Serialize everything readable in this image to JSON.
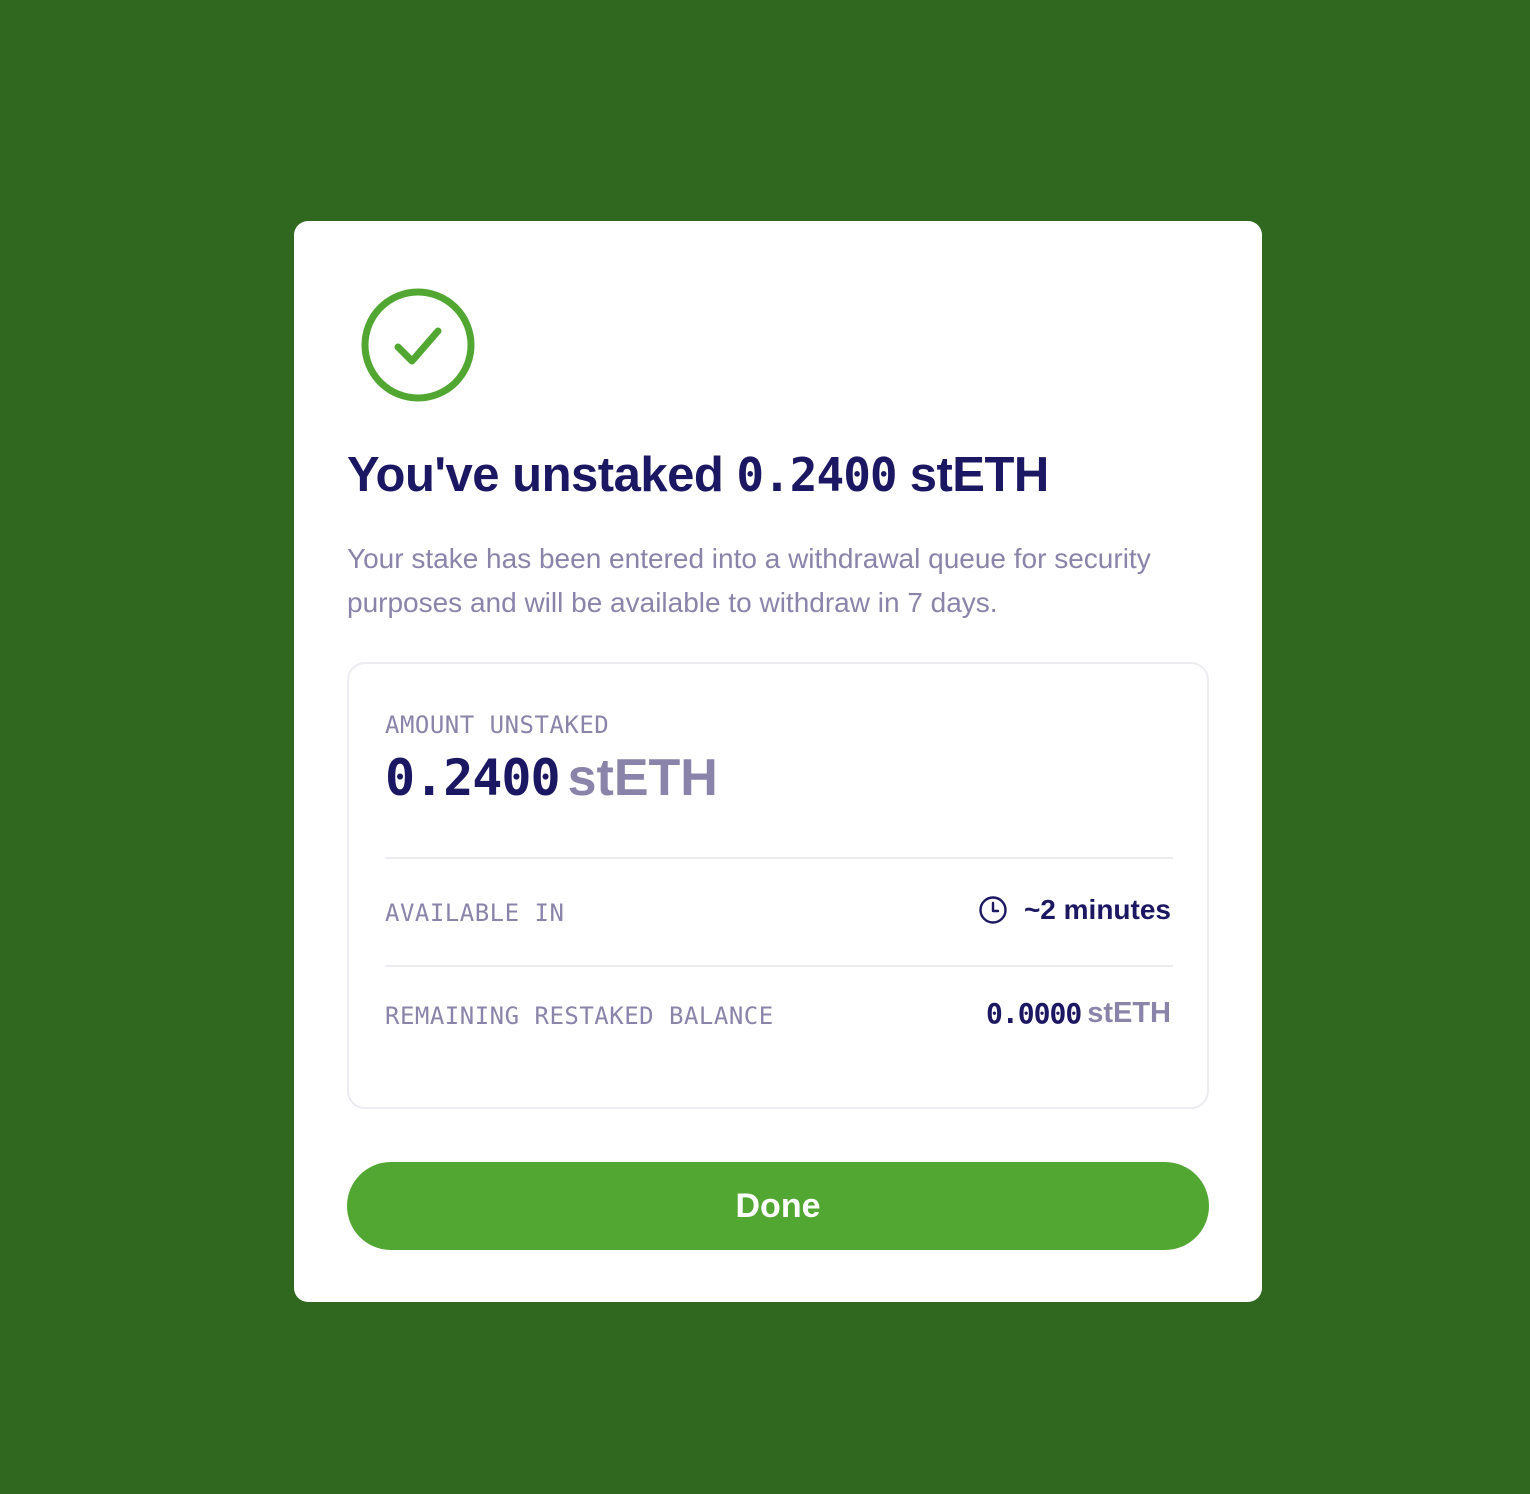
{
  "modal": {
    "icon": "check-circle-icon",
    "title_prefix": "You've unstaked",
    "title_amount": "0.2400",
    "title_unit": "stETH",
    "subtitle": "Your stake has been entered into a withdrawal queue for security purposes and will be available to withdraw in 7 days."
  },
  "summary": {
    "amount_label": "AMOUNT UNSTAKED",
    "amount_value": "0.2400",
    "amount_unit": "stETH",
    "available_label": "AVAILABLE IN",
    "available_icon": "clock-icon",
    "available_value": "~2 minutes",
    "remaining_label": "REMAINING RESTAKED BALANCE",
    "remaining_value": "0.0000",
    "remaining_unit": "stETH"
  },
  "actions": {
    "done_label": "Done"
  },
  "colors": {
    "background": "#306820",
    "accent_green": "#52a733",
    "text_primary": "#1b1762",
    "text_muted": "#8a84ab",
    "card_border": "#ececf1"
  }
}
